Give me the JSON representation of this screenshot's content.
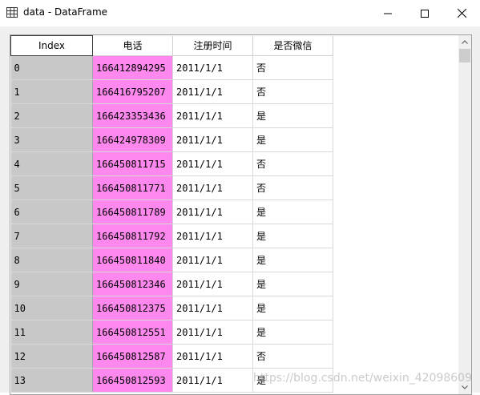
{
  "window": {
    "title": "data - DataFrame",
    "icon": "table-grid-icon"
  },
  "table": {
    "columns": [
      "Index",
      "电话",
      "注册时间",
      "是否微信"
    ],
    "rows": [
      {
        "index": "0",
        "phone": "166412894295",
        "date": "2011/1/1",
        "wechat": "否"
      },
      {
        "index": "1",
        "phone": "166416795207",
        "date": "2011/1/1",
        "wechat": "否"
      },
      {
        "index": "2",
        "phone": "166423353436",
        "date": "2011/1/1",
        "wechat": "是"
      },
      {
        "index": "3",
        "phone": "166424978309",
        "date": "2011/1/1",
        "wechat": "是"
      },
      {
        "index": "4",
        "phone": "166450811715",
        "date": "2011/1/1",
        "wechat": "否"
      },
      {
        "index": "5",
        "phone": "166450811771",
        "date": "2011/1/1",
        "wechat": "否"
      },
      {
        "index": "6",
        "phone": "166450811789",
        "date": "2011/1/1",
        "wechat": "是"
      },
      {
        "index": "7",
        "phone": "166450811792",
        "date": "2011/1/1",
        "wechat": "是"
      },
      {
        "index": "8",
        "phone": "166450811840",
        "date": "2011/1/1",
        "wechat": "是"
      },
      {
        "index": "9",
        "phone": "166450812346",
        "date": "2011/1/1",
        "wechat": "是"
      },
      {
        "index": "10",
        "phone": "166450812375",
        "date": "2011/1/1",
        "wechat": "是"
      },
      {
        "index": "11",
        "phone": "166450812551",
        "date": "2011/1/1",
        "wechat": "是"
      },
      {
        "index": "12",
        "phone": "166450812587",
        "date": "2011/1/1",
        "wechat": "否"
      },
      {
        "index": "13",
        "phone": "166450812593",
        "date": "2011/1/1",
        "wechat": "是"
      }
    ]
  },
  "colors": {
    "index_column": "#c8c8c8",
    "phone_column": "#ff88ee"
  },
  "watermark": "https://blog.csdn.net/weixin_42098609"
}
